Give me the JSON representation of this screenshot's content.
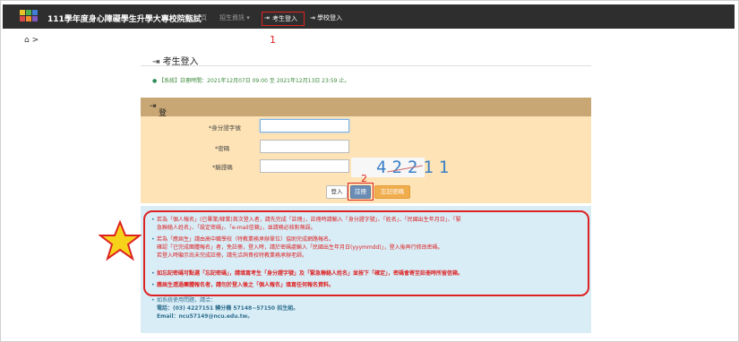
{
  "nav": {
    "brand": "111學年度身心障礙學生升學大專校院甄試",
    "home": "首頁",
    "admissions": "招生資訊 ▾",
    "student_login": "考生登入",
    "school_login": "學校登入"
  },
  "annotations": {
    "one": "1",
    "two": "2"
  },
  "breadcrumb": "⌂ >",
  "page_title": "考生登入",
  "notice": "【系統】註冊時間：2021年12月07日 09:00 至 2021年12月13日 23:59 止。",
  "panel": {
    "title": "登入",
    "id_label": "*身分證字號",
    "password_label": "*密碼",
    "captcha_label": "*驗證碼",
    "captcha_text": "42211",
    "login_btn": "登入",
    "register_btn": "註冊",
    "forgot_btn": "忘記密碼"
  },
  "info": {
    "item1_a": "若為「個人報名」(已畢業/肄業)首次登入者，請先完成「註冊」，註冊時請輸入「身分證字號」、「姓名」、「民國出生年月日」、「緊",
    "item1_b": "急聯絡人姓名」、「設定密碼」、「e-mail信箱」，並請務必核對無誤。",
    "item2_a": "若為「應屆生」請由高中職學校（特教業務承辦單位）協助完成網路報名。",
    "item2_b": "確認「已完成團體報名」者，免註冊，登入時，請於密碼處輸入「民國出生年月日(yyymmdd)」，登入後再行修改密碼。",
    "item2_c": "若登入時顯示尚未完成註冊，請先洽詢貴校特教業務承辦老師。",
    "item3": "如忘記密碼可點選「忘記密碼」，請填寫考生「身分證字號」及「緊急聯絡人姓名」並按下「確定」，密碼會寄至註冊時所留信箱。",
    "item4": "應屆生透過團體報名者，請勿於登入後之「個人報名」填寫任何報名資料。",
    "item5_a": "如系統使用問題，請洽：",
    "item5_b": "電話：(03) 4227151 轉分機 57148~57150 招生組。",
    "item5_c": "Email：ncu57149@ncu.edu.tw。"
  },
  "colors": {
    "navbar": "#2e2e2e",
    "panel_head": "#c8a774",
    "panel_body": "#fde3b6",
    "info_bg": "#d9edf7",
    "annotation": "#dd2222"
  }
}
